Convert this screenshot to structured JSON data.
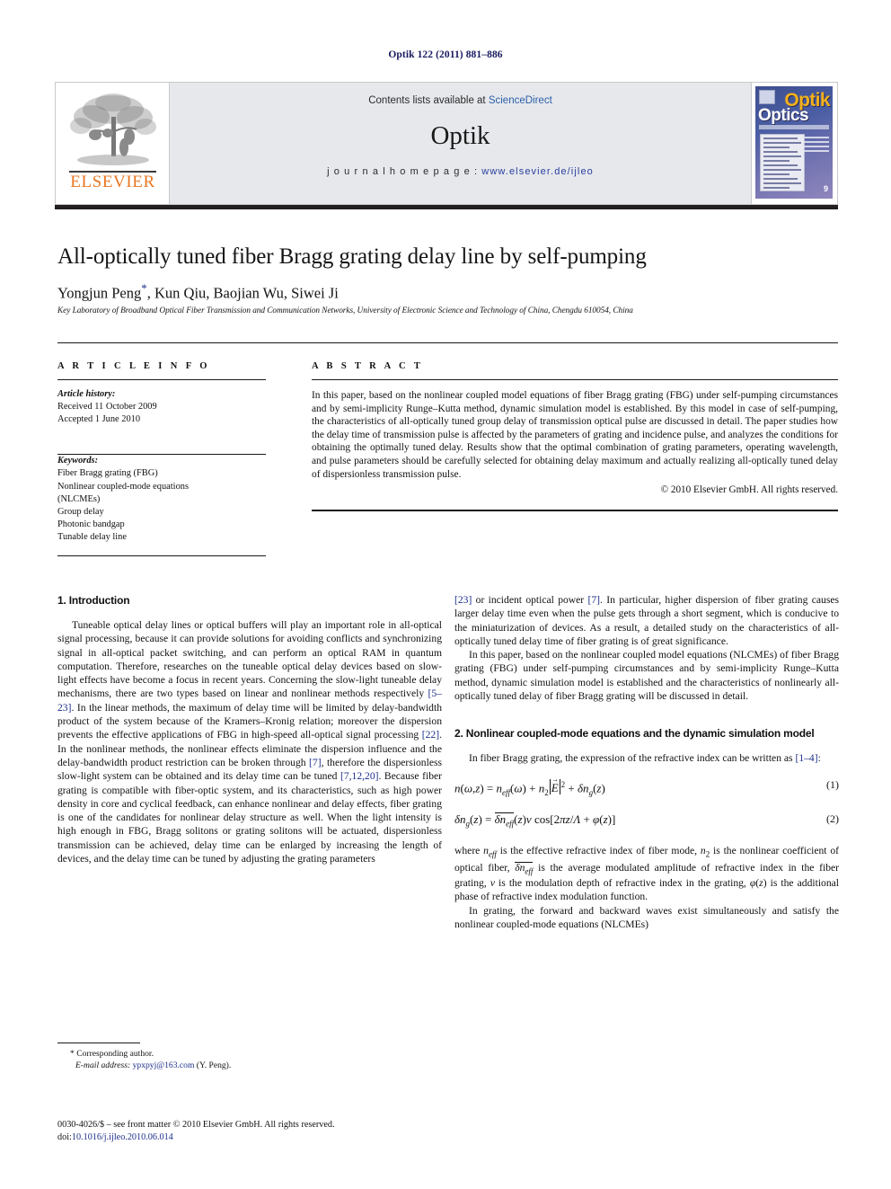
{
  "running_head": "Optik 122 (2011) 881–886",
  "journal_header": {
    "contents_prefix": "Contents lists available at ",
    "contents_link": "ScienceDirect",
    "journal_name": "Optik",
    "homepage_label": "j o u r n a l   h o m e p a g e :  ",
    "homepage_url": "www.elsevier.de/ijleo",
    "publisher_logo_text": "ELSEVIER",
    "cover": {
      "title_top": "Optik",
      "title_bottom": "Optics",
      "issue_badge": "9"
    }
  },
  "article": {
    "title": "All-optically tuned fiber Bragg grating delay line by self-pumping",
    "authors": "Yongjun Peng, Kun Qiu, Baojian Wu, Siwei Ji",
    "authors_before_star": "Yongjun Peng",
    "authors_after_star": ", Kun Qiu, Baojian Wu, Siwei Ji",
    "corresponding_marker": "*",
    "affiliation": "Key Laboratory of Broadband Optical Fiber Transmission and Communication Networks, University of Electronic Science and Technology of China, Chengdu 610054, China"
  },
  "article_info": {
    "heading": "A R T I C L E   I N F O",
    "history_label": "Article history:",
    "received": "Received 11 October 2009",
    "accepted": "Accepted 1 June 2010",
    "keywords_label": "Keywords:",
    "keywords": [
      "Fiber Bragg grating (FBG)",
      "Nonlinear coupled-mode equations",
      "(NLCMEs)",
      "Group delay",
      "Photonic bandgap",
      "Tunable delay line"
    ]
  },
  "abstract": {
    "heading": "A B S T R A C T",
    "text": "In this paper, based on the nonlinear coupled model equations of fiber Bragg grating (FBG) under self-pumping circumstances and by semi-implicity Runge–Kutta method, dynamic simulation model is established. By this model in case of self-pumping, the characteristics of all-optically tuned group delay of transmission optical pulse are discussed in detail. The paper studies how the delay time of transmission pulse is affected by the parameters of grating and incidence pulse, and analyzes the conditions for obtaining the optimally tuned delay. Results show that the optimal combination of grating parameters, operating wavelength, and pulse parameters should be carefully selected for obtaining delay maximum and actually realizing all-optically tuned delay of dispersionless transmission pulse.",
    "copyright": "© 2010 Elsevier GmbH. All rights reserved."
  },
  "body": {
    "section1_heading": "1.  Introduction",
    "section1_p1_a": "Tuneable optical delay lines or optical buffers will play an important role in all-optical signal processing, because it can provide solutions for avoiding conflicts and synchronizing signal in all-optical packet switching, and can perform an optical RAM in quantum computation. Therefore, researches on the tuneable optical delay devices based on slow-light effects have become a focus in recent years. Concerning the slow-light tuneable delay mechanisms, there are two types based on linear and nonlinear methods respectively ",
    "ref_5_23": "[5–23]",
    "section1_p1_b": ". In the linear methods, the maximum of delay time will be limited by delay-bandwidth product of the system because of the Kramers–Kronig relation; moreover the dispersion prevents the effective applications of FBG in high-speed all-optical signal processing ",
    "ref_22": "[22]",
    "section1_p1_c": ". In the nonlinear methods, the nonlinear effects eliminate the dispersion influence and the delay-bandwidth product restriction can be broken through ",
    "ref_7": "[7]",
    "section1_p1_d": ", therefore the dispersionless slow-light system can be obtained and its delay time can be tuned ",
    "ref_7_12_20": "[7,12,20]",
    "section1_p1_e": ". Because fiber grating is compatible with fiber-optic system, and its characteristics, such as high power density in core and cyclical feedback, can enhance nonlinear and delay effects, fiber grating is one of the candidates for nonlinear delay structure as well. When the light intensity is high enough in FBG, Bragg solitons or grating solitons will be actuated, dispersionless transmission can be achieved, delay time can be enlarged by increasing the length of devices, and the delay time can be tuned by adjusting the grating parameters ",
    "ref_23": "[23]",
    "section1_p1_f": " or incident optical power ",
    "ref_7b": "[7]",
    "section1_p1_g": ". In particular, higher dispersion of fiber grating causes larger delay time even when the pulse gets through a short segment, which is conducive to the miniaturization of devices. As a result, a detailed study on the characteristics of all-optically tuned delay time of fiber grating is of great significance.",
    "section1_p2": "In this paper, based on the nonlinear coupled model equations (NLCMEs) of fiber Bragg grating (FBG) under self-pumping circumstances and by semi-implicity Runge–Kutta method, dynamic simulation model is established and the characteristics of nonlinearly all-optically tuned delay of fiber Bragg grating will be discussed in detail.",
    "section2_heading": "2.  Nonlinear coupled-mode equations and the dynamic simulation model",
    "section2_p1_a": "In fiber Bragg grating, the expression of the refractive index can be written as ",
    "ref_1_4": "[1–4]",
    "section2_p1_b": ":",
    "eq1_number": "(1)",
    "eq2_number": "(2)",
    "section2_p2": "where n<sub>eff</sub> is the effective refractive index of fiber mode, n2 is the nonlinear coefficient of optical fiber, δn_eff is the average modulated amplitude of refractive index in the fiber grating, ν is the modulation depth of refractive index in the grating, φ(z) is the additional phase of refractive index modulation function.",
    "section2_p3": "In grating, the forward and backward waves exist simultaneously and satisfy the nonlinear coupled-mode equations (NLCMEs)"
  },
  "footnote": {
    "corresponding": "* Corresponding author.",
    "email_label": "E-mail address:",
    "email": "ypxpyj@163.com",
    "email_suffix": " (Y. Peng).",
    "frontmatter": "0030-4026/$ – see front matter © 2010 Elsevier GmbH. All rights reserved.",
    "doi_label": "doi:",
    "doi": "10.1016/j.ijleo.2010.06.014"
  }
}
